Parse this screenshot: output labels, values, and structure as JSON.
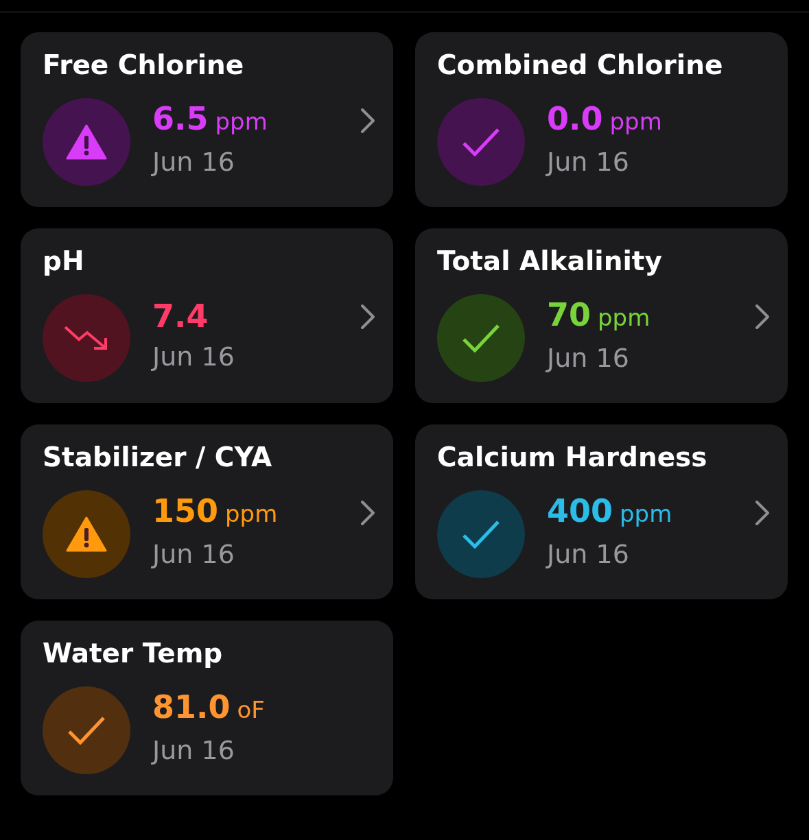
{
  "cards": [
    {
      "title": "Free Chlorine",
      "kind": "warning",
      "color": "#d83cf8",
      "value": "6.5",
      "unit": "ppm",
      "date": "Jun 16",
      "chevron": true
    },
    {
      "title": "Combined Chlorine",
      "kind": "ok",
      "color": "#d83cf8",
      "value": "0.0",
      "unit": "ppm",
      "date": "Jun 16",
      "chevron": false
    },
    {
      "title": "pH",
      "kind": "falling",
      "color": "#ff3b68",
      "value": "7.4",
      "date": "Jun 16",
      "chevron": true
    },
    {
      "title": "Total Alkalinity",
      "kind": "ok",
      "color": "#78d43a",
      "value": "70",
      "unit": "ppm",
      "date": "Jun 16",
      "chevron": true
    },
    {
      "title": "Stabilizer / CYA",
      "kind": "warning",
      "color": "#ff9a0e",
      "value": "150",
      "unit": "ppm",
      "date": "Jun 16",
      "chevron": true
    },
    {
      "title": "Calcium Hardness",
      "kind": "ok",
      "color": "#2bbce8",
      "value": "400",
      "unit": "ppm",
      "date": "Jun 16",
      "chevron": true
    },
    {
      "title": "Water Temp",
      "kind": "ok",
      "color": "#ff9430",
      "value": "81.0",
      "unit": "oF",
      "date": "Jun 16",
      "chevron": false
    }
  ]
}
